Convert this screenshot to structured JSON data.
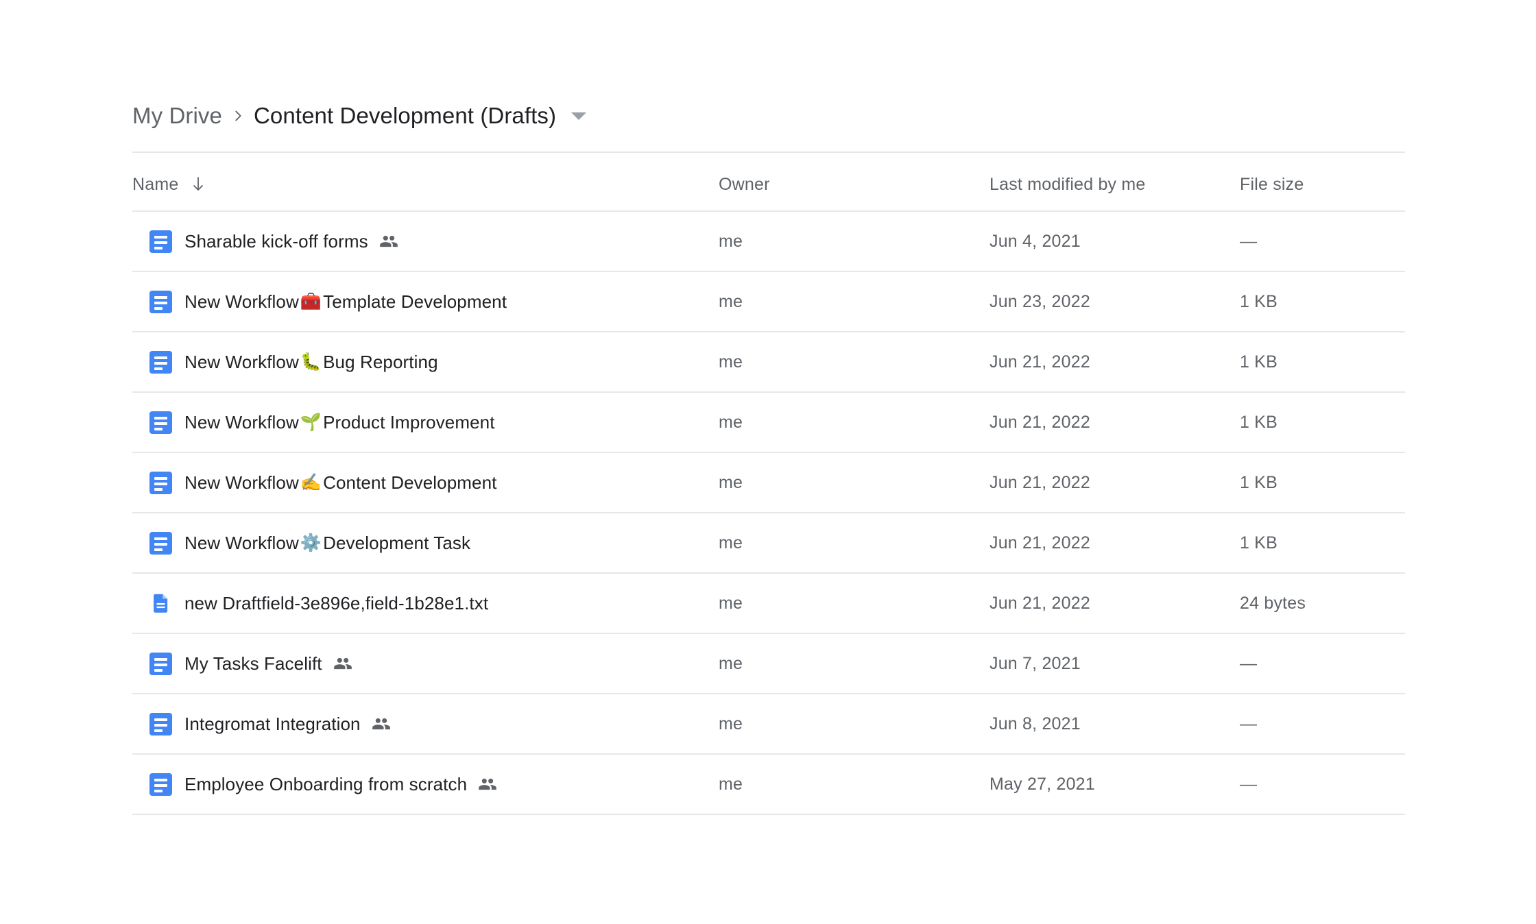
{
  "breadcrumb": {
    "root_label": "My Drive",
    "separator_icon": "chevron-right-icon",
    "current_label": "Content Development (Drafts)",
    "caret_icon": "chevron-down-icon"
  },
  "colors": {
    "doc_blue": "#4285f4",
    "text_primary": "#202124",
    "text_secondary": "#5f6368",
    "divider": "#e6e7ea",
    "background": "#ffffff"
  },
  "table": {
    "columns": {
      "name": "Name",
      "owner": "Owner",
      "modified": "Last modified by me",
      "size": "File size"
    },
    "sort": {
      "column": "Name",
      "icon": "arrow-down-icon",
      "direction": "descending"
    },
    "rows": [
      {
        "icon": "google-docs-icon",
        "name_prefix": "Sharable kick-off forms",
        "emoji": "",
        "name_suffix": "",
        "shared": true,
        "owner": "me",
        "modified": "Jun 4, 2021",
        "size": "—"
      },
      {
        "icon": "google-docs-icon",
        "name_prefix": "New Workflow ",
        "emoji": "🧰",
        "name_suffix": " Template Development",
        "shared": false,
        "owner": "me",
        "modified": "Jun 23, 2022",
        "size": "1 KB"
      },
      {
        "icon": "google-docs-icon",
        "name_prefix": "New Workflow ",
        "emoji": "🐛",
        "name_suffix": " Bug Reporting",
        "shared": false,
        "owner": "me",
        "modified": "Jun 21, 2022",
        "size": "1 KB"
      },
      {
        "icon": "google-docs-icon",
        "name_prefix": "New Workflow ",
        "emoji": "🌱",
        "name_suffix": " Product Improvement",
        "shared": false,
        "owner": "me",
        "modified": "Jun 21, 2022",
        "size": "1 KB"
      },
      {
        "icon": "google-docs-icon",
        "name_prefix": "New Workflow ",
        "emoji": "✍️",
        "name_suffix": " Content Development",
        "shared": false,
        "owner": "me",
        "modified": "Jun 21, 2022",
        "size": "1 KB"
      },
      {
        "icon": "google-docs-icon",
        "name_prefix": "New Workflow ",
        "emoji": "⚙️",
        "name_suffix": " Development Task",
        "shared": false,
        "owner": "me",
        "modified": "Jun 21, 2022",
        "size": "1 KB"
      },
      {
        "icon": "text-file-icon",
        "name_prefix": "new Draftfield-3e896e,field-1b28e1.txt",
        "emoji": "",
        "name_suffix": "",
        "shared": false,
        "owner": "me",
        "modified": "Jun 21, 2022",
        "size": "24 bytes"
      },
      {
        "icon": "google-docs-icon",
        "name_prefix": "My Tasks Facelift",
        "emoji": "",
        "name_suffix": "",
        "shared": true,
        "owner": "me",
        "modified": "Jun 7, 2021",
        "size": "—"
      },
      {
        "icon": "google-docs-icon",
        "name_prefix": "Integromat Integration",
        "emoji": "",
        "name_suffix": "",
        "shared": true,
        "owner": "me",
        "modified": "Jun 8, 2021",
        "size": "—"
      },
      {
        "icon": "google-docs-icon",
        "name_prefix": "Employee Onboarding from scratch",
        "emoji": "",
        "name_suffix": "",
        "shared": true,
        "owner": "me",
        "modified": "May 27, 2021",
        "size": "—"
      }
    ]
  }
}
